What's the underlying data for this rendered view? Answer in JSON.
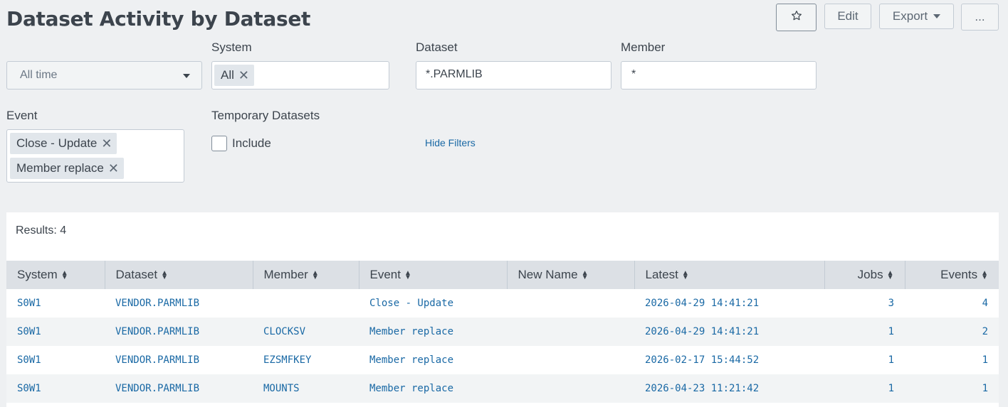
{
  "title": "Dataset Activity by Dataset",
  "toolbar": {
    "edit": "Edit",
    "export": "Export",
    "more": "..."
  },
  "filters": {
    "time": {
      "value": "All time"
    },
    "system": {
      "label": "System",
      "chip": "All"
    },
    "dataset": {
      "label": "Dataset",
      "value": "*.PARMLIB"
    },
    "member": {
      "label": "Member",
      "value": "*"
    },
    "event": {
      "label": "Event",
      "chips": [
        "Close - Update",
        "Member replace"
      ]
    },
    "temp": {
      "label": "Temporary Datasets",
      "checkbox": "Include"
    },
    "hide": "Hide Filters"
  },
  "results": "Results: 4",
  "table": {
    "headers": [
      "System",
      "Dataset",
      "Member",
      "Event",
      "New Name",
      "Latest",
      "Jobs",
      "Events"
    ],
    "rows": [
      [
        "S0W1",
        "VENDOR.PARMLIB",
        "",
        "Close - Update",
        "",
        "2026-04-29 14:41:21",
        "3",
        "4"
      ],
      [
        "S0W1",
        "VENDOR.PARMLIB",
        "CLOCKSV",
        "Member replace",
        "",
        "2026-04-29 14:41:21",
        "1",
        "2"
      ],
      [
        "S0W1",
        "VENDOR.PARMLIB",
        "EZSMFKEY",
        "Member replace",
        "",
        "2026-02-17 15:44:52",
        "1",
        "1"
      ],
      [
        "S0W1",
        "VENDOR.PARMLIB",
        "MOUNTS",
        "Member replace",
        "",
        "2026-04-23 11:21:42",
        "1",
        "1"
      ]
    ]
  }
}
